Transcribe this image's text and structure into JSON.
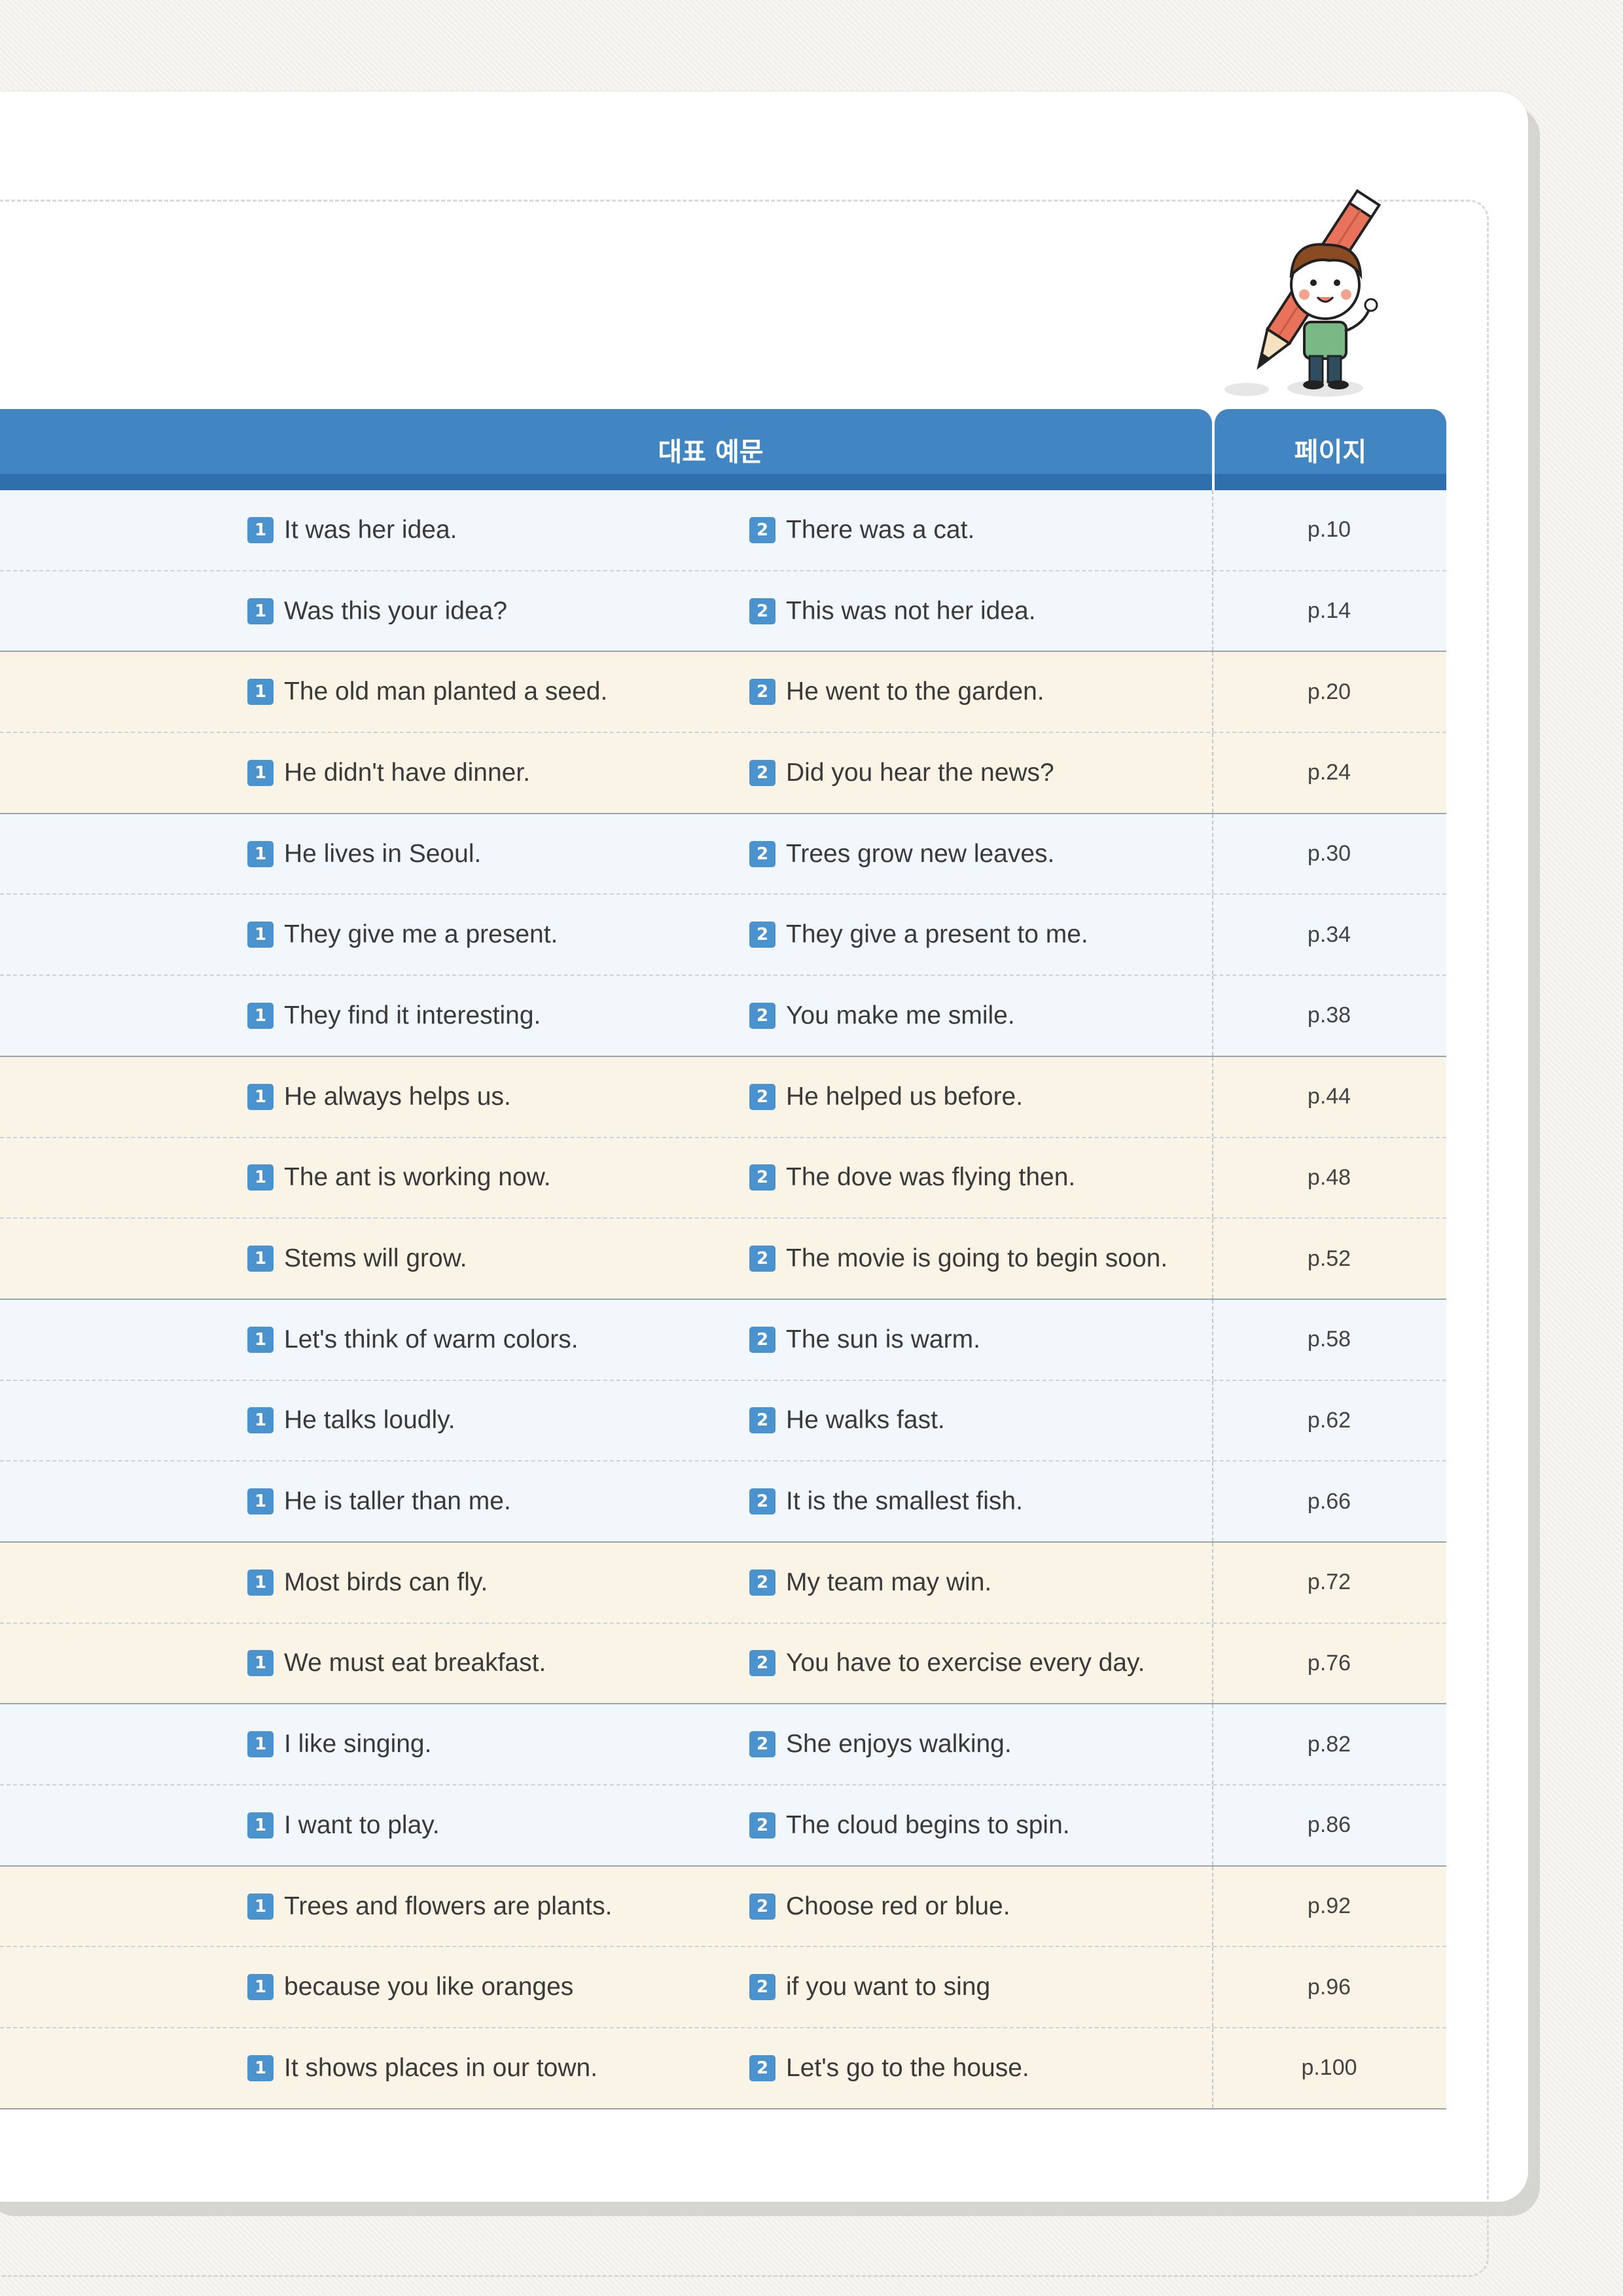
{
  "header": {
    "example_label": "대표 예문",
    "page_label": "페이지"
  },
  "rows": [
    {
      "ex1": "It was her idea.",
      "ex2": "There was a cat.",
      "page": "p.10",
      "tone": "blue",
      "end": false
    },
    {
      "ex1": "Was this your idea?",
      "ex2": "This was not her idea.",
      "page": "p.14",
      "tone": "blue",
      "end": true
    },
    {
      "ex1": "The old man planted a seed.",
      "ex2": "He went to the garden.",
      "page": "p.20",
      "tone": "cream",
      "end": false
    },
    {
      "ex1": "He didn't have dinner.",
      "ex2": "Did you hear the news?",
      "page": "p.24",
      "tone": "cream",
      "end": true
    },
    {
      "ex1": "He lives in Seoul.",
      "ex2": "Trees grow new leaves.",
      "page": "p.30",
      "tone": "blue",
      "end": false
    },
    {
      "ex1": "They give me a present.",
      "ex2": "They give a present to me.",
      "page": "p.34",
      "tone": "blue",
      "end": false
    },
    {
      "ex1": "They find it interesting.",
      "ex2": "You make me smile.",
      "page": "p.38",
      "tone": "blue",
      "end": true
    },
    {
      "ex1": "He always helps us.",
      "ex2": "He helped us before.",
      "page": "p.44",
      "tone": "cream",
      "end": false
    },
    {
      "ex1": "The ant is working now.",
      "ex2": "The dove was flying then.",
      "page": "p.48",
      "tone": "cream",
      "end": false
    },
    {
      "ex1": "Stems will grow.",
      "ex2": "The movie is going to begin soon.",
      "page": "p.52",
      "tone": "cream",
      "end": true
    },
    {
      "ex1": "Let's think of warm colors.",
      "ex2": "The sun is warm.",
      "page": "p.58",
      "tone": "blue",
      "end": false
    },
    {
      "ex1": "He talks loudly.",
      "ex2": "He walks fast.",
      "page": "p.62",
      "tone": "blue",
      "end": false
    },
    {
      "ex1": "He is taller than me.",
      "ex2": "It is the smallest fish.",
      "page": "p.66",
      "tone": "blue",
      "end": true
    },
    {
      "ex1": "Most birds can fly.",
      "ex2": "My team may win.",
      "page": "p.72",
      "tone": "cream",
      "end": false
    },
    {
      "ex1": "We must eat breakfast.",
      "ex2": "You have to exercise every day.",
      "page": "p.76",
      "tone": "cream",
      "end": true
    },
    {
      "ex1": "I like singing.",
      "ex2": "She enjoys walking.",
      "page": "p.82",
      "tone": "blue",
      "end": false
    },
    {
      "ex1": "I want to play.",
      "ex2": "The cloud begins to spin.",
      "page": "p.86",
      "tone": "blue",
      "end": true
    },
    {
      "ex1": "Trees and flowers are plants.",
      "ex2": "Choose red or blue.",
      "page": "p.92",
      "tone": "cream",
      "end": false
    },
    {
      "ex1": "because you like oranges",
      "ex2": "if you want to sing",
      "page": "p.96",
      "tone": "cream",
      "end": false
    },
    {
      "ex1": "It shows places in our town.",
      "ex2": "Let's go to the house.",
      "page": "p.100",
      "tone": "cream",
      "end": true
    }
  ],
  "badges": {
    "one": "1",
    "two": "2"
  },
  "colors": {
    "header_blue": "#4186c3",
    "badge_blue": "#4b93cf",
    "row_blue": "#f2f7fc",
    "row_cream": "#f9f4e6"
  }
}
